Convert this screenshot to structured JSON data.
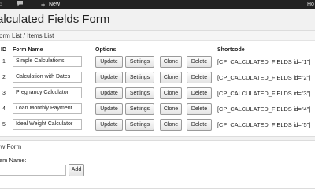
{
  "adminbar": {
    "left_fragment": "5",
    "new_label": "New",
    "howdy_fragment": "Ho"
  },
  "page_title": "alculated Fields Form",
  "list_section": {
    "title": "orm List / Items List"
  },
  "table": {
    "headers": {
      "id": "ID",
      "name": "Form Name",
      "options": "Options",
      "shortcode": "Shortcode"
    },
    "buttons": {
      "update": "Update",
      "settings": "Settings",
      "clone": "Clone",
      "delete": "Delete"
    },
    "rows": [
      {
        "id": "1",
        "name": "Simple Calculations",
        "shortcode": "[CP_CALCULATED_FIELDS id=\"1\"]"
      },
      {
        "id": "2",
        "name": "Calculation with Dates",
        "shortcode": "[CP_CALCULATED_FIELDS id=\"2\"]"
      },
      {
        "id": "3",
        "name": "Pregnancy Calculator",
        "shortcode": "[CP_CALCULATED_FIELDS id=\"3\"]"
      },
      {
        "id": "4",
        "name": "Loan Monthly Payment",
        "shortcode": "[CP_CALCULATED_FIELDS id=\"4\"]"
      },
      {
        "id": "5",
        "name": "Ideal Weight Calculator",
        "shortcode": "[CP_CALCULATED_FIELDS id=\"5\"]"
      }
    ]
  },
  "new_section": {
    "title": "ew Form",
    "item_name_label": "em Name:",
    "item_name_value": "",
    "add_label": "Add"
  }
}
